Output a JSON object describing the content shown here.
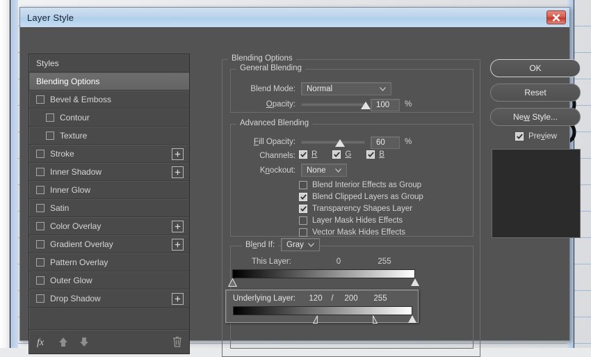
{
  "window": {
    "title": "Layer Style",
    "close_icon": "close-x-icon"
  },
  "styles_panel": {
    "header": "Styles",
    "items": [
      {
        "label": "Blending Options",
        "checkbox": null,
        "selected": true,
        "indent": false,
        "plus": false
      },
      {
        "label": "Bevel & Emboss",
        "checkbox": false,
        "selected": false,
        "indent": false,
        "plus": false
      },
      {
        "label": "Contour",
        "checkbox": false,
        "selected": false,
        "indent": true,
        "plus": false
      },
      {
        "label": "Texture",
        "checkbox": false,
        "selected": false,
        "indent": true,
        "plus": false
      },
      {
        "label": "Stroke",
        "checkbox": false,
        "selected": false,
        "indent": false,
        "plus": true
      },
      {
        "label": "Inner Shadow",
        "checkbox": false,
        "selected": false,
        "indent": false,
        "plus": true
      },
      {
        "label": "Inner Glow",
        "checkbox": false,
        "selected": false,
        "indent": false,
        "plus": false
      },
      {
        "label": "Satin",
        "checkbox": false,
        "selected": false,
        "indent": false,
        "plus": false
      },
      {
        "label": "Color Overlay",
        "checkbox": false,
        "selected": false,
        "indent": false,
        "plus": true
      },
      {
        "label": "Gradient Overlay",
        "checkbox": false,
        "selected": false,
        "indent": false,
        "plus": true
      },
      {
        "label": "Pattern Overlay",
        "checkbox": false,
        "selected": false,
        "indent": false,
        "plus": false
      },
      {
        "label": "Outer Glow",
        "checkbox": false,
        "selected": false,
        "indent": false,
        "plus": false
      },
      {
        "label": "Drop Shadow",
        "checkbox": false,
        "selected": false,
        "indent": false,
        "plus": true
      }
    ],
    "toolbar": {
      "fx_icon": "fx-icon",
      "move_up_icon": "arrow-up-icon",
      "move_down_icon": "arrow-down-icon",
      "delete_icon": "trash-icon"
    }
  },
  "blending_options": {
    "group_label": "Blending Options",
    "general": {
      "group_label": "General Blending",
      "blend_mode_label": "Blend Mode:",
      "blend_mode_value": "Normal",
      "opacity_label": "Opacity:",
      "opacity_value": "100",
      "opacity_percent": 100,
      "percent_sign": "%"
    },
    "advanced": {
      "group_label": "Advanced Blending",
      "fill_opacity_label": "Fill Opacity:",
      "fill_opacity_value": "60",
      "fill_opacity_percent": 60,
      "percent_sign": "%",
      "channels_label": "Channels:",
      "channels": [
        {
          "label": "R",
          "checked": true
        },
        {
          "label": "G",
          "checked": true
        },
        {
          "label": "B",
          "checked": true
        }
      ],
      "knockout_label": "Knockout:",
      "knockout_value": "None",
      "options": [
        {
          "label": "Blend Interior Effects as Group",
          "checked": false
        },
        {
          "label": "Blend Clipped Layers as Group",
          "checked": true
        },
        {
          "label": "Transparency Shapes Layer",
          "checked": true
        },
        {
          "label": "Layer Mask Hides Effects",
          "checked": false
        },
        {
          "label": "Vector Mask Hides Effects",
          "checked": false
        }
      ]
    },
    "blend_if": {
      "label": "Blend If:",
      "channel_value": "Gray",
      "this_layer": {
        "label": "This Layer:",
        "black_value": "0",
        "white_value": "255",
        "black_point": 0,
        "white_point": 255
      },
      "underlying_layer": {
        "label": "Underlying Layer:",
        "black_value": "120",
        "separator": "/",
        "black_split_value": "200",
        "white_value": "255",
        "black_point": 120,
        "black_split_point": 200,
        "white_point": 255
      }
    }
  },
  "buttons": {
    "ok": "OK",
    "reset": "Reset",
    "new_style": "New Style...",
    "preview_label": "Preview",
    "preview_checked": true
  },
  "preview_swatch": {
    "color": "#2b2b2b"
  },
  "colors": {
    "dialog_bg": "#535353",
    "panel_bg": "#4a4a4a",
    "titlebar": "#bdd3ea",
    "close_red": "#c0392b",
    "text": "#d2d2d2",
    "selected_row": "#6e6e6e"
  }
}
